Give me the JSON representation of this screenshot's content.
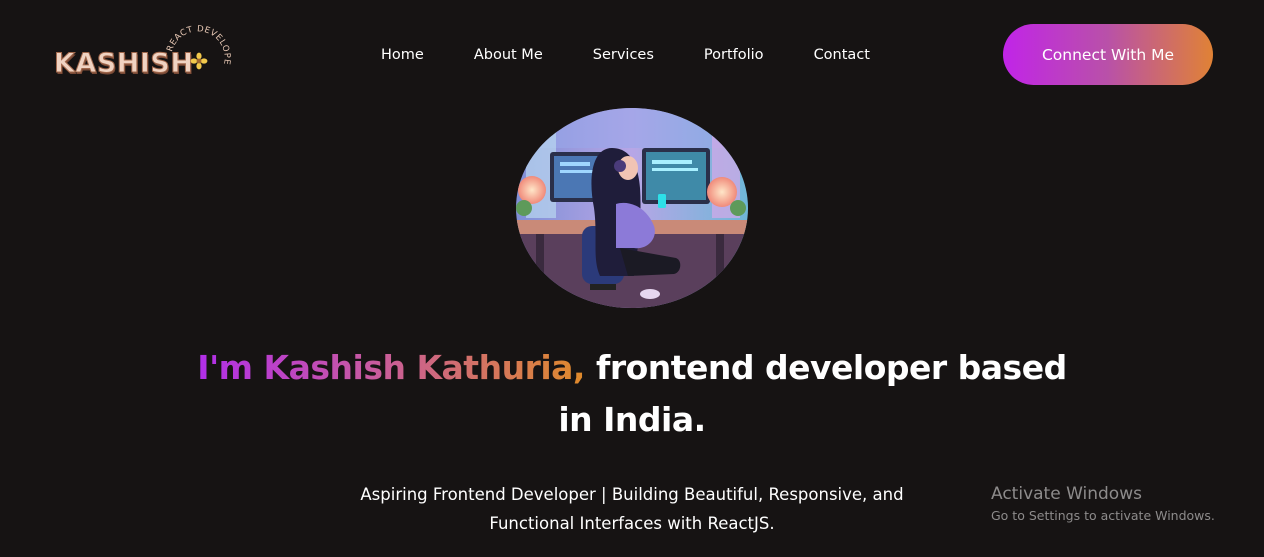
{
  "header": {
    "logo": {
      "name": "KASHISH",
      "tagline": "REACT DEVELOPER"
    },
    "nav": [
      {
        "label": "Home"
      },
      {
        "label": "About Me"
      },
      {
        "label": "Services"
      },
      {
        "label": "Portfolio"
      },
      {
        "label": "Contact"
      }
    ],
    "cta_label": "Connect With Me"
  },
  "hero": {
    "image_icon": "developer-girl-illustration",
    "headline_name": "I'm Kashish Kathuria,",
    "headline_rest": " frontend developer based in India.",
    "subtitle": "Aspiring Frontend Developer | Building Beautiful, Responsive, and Functional Interfaces with ReactJS."
  },
  "watermark": {
    "title": "Activate Windows",
    "subtitle": "Go to Settings to activate Windows."
  },
  "colors": {
    "background": "#161313",
    "gradient_start": "#c124e8",
    "gradient_end": "#e08235",
    "text": "#ffffff"
  }
}
